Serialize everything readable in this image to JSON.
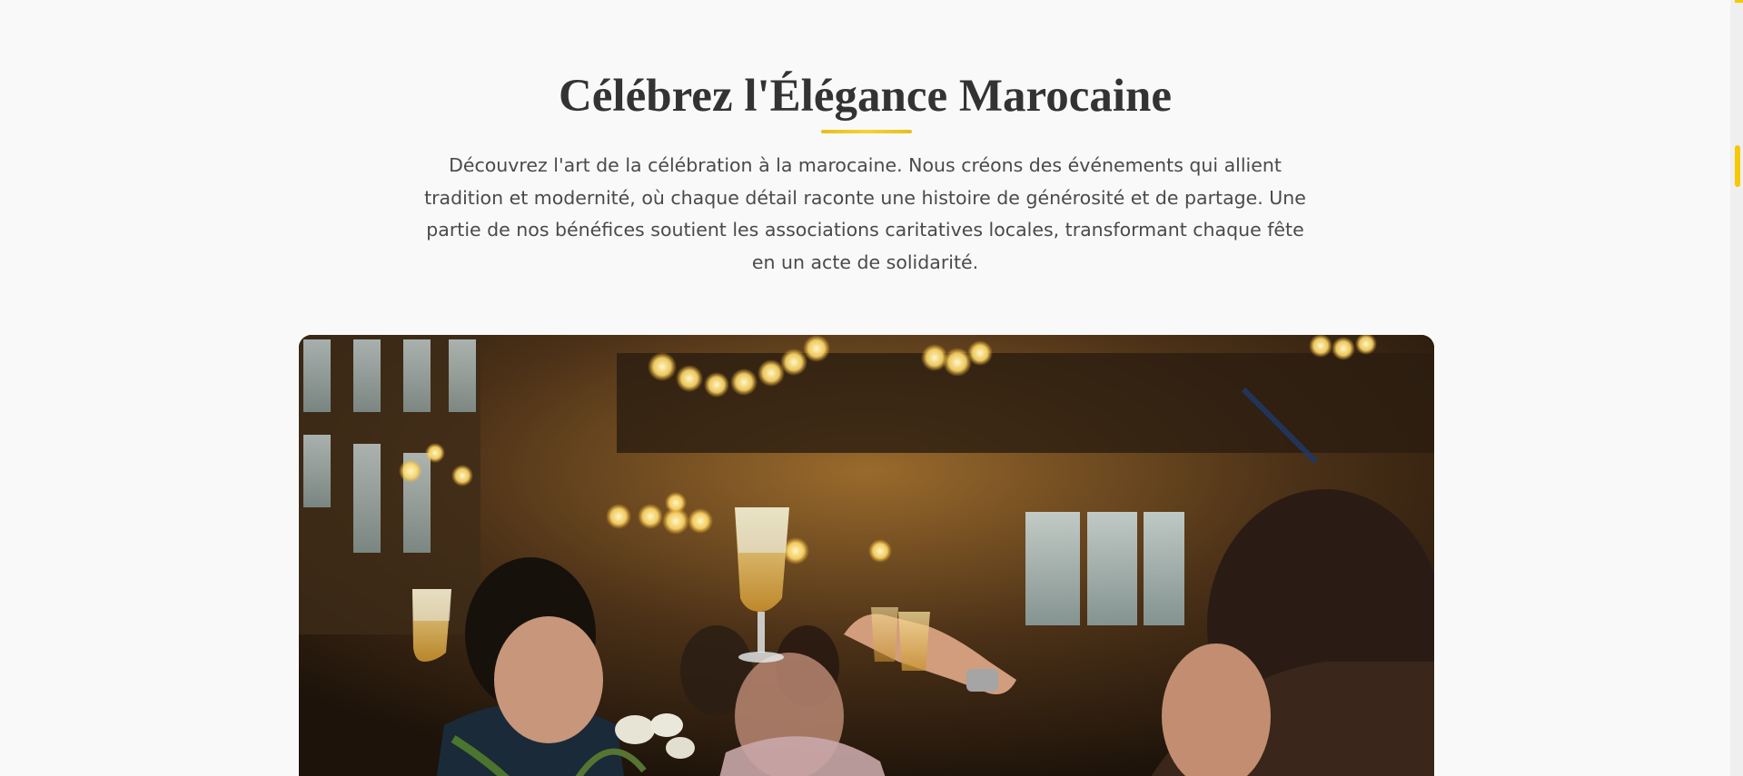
{
  "hero": {
    "title": "Célébrez l'Élégance Marocaine",
    "intro": "Découvrez l'art de la célébration à la marocaine. Nous créons des événements qui allient tradition et modernité, où chaque détail raconte une histoire de générosité et de partage. Une partie de nos bénéfices soutient les associations caritatives locales, transformant chaque fête en un acte de solidarité."
  },
  "colors": {
    "accent": "#f5c800",
    "title": "#333333",
    "text": "#4a4a4a",
    "background": "#f9f9f9"
  },
  "image": {
    "subject": "celebration-toast-photo"
  },
  "scroll": {
    "position": 0.19
  }
}
